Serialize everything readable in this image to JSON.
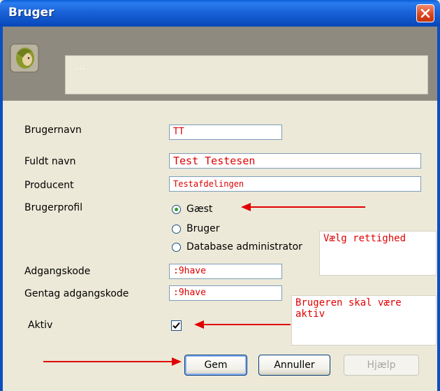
{
  "window": {
    "title": "Bruger"
  },
  "header": {
    "field_text": "..."
  },
  "form": {
    "username": {
      "label": "Brugernavn",
      "value": "TT"
    },
    "fullname": {
      "label": "Fuldt navn",
      "value": "Test Testesen"
    },
    "producer": {
      "label": "Producent",
      "value": "Testafdelingen"
    },
    "profile": {
      "label": "Brugerprofil",
      "options": [
        "Gæst",
        "Bruger",
        "Database administrator"
      ],
      "selected": "Gæst"
    },
    "password": {
      "label": "Adgangskode",
      "value": ":9have"
    },
    "password_repeat": {
      "label": "Gentag adgangskode",
      "value": ":9have"
    },
    "active": {
      "label": "Aktiv",
      "checked": true
    }
  },
  "annotations": {
    "rights_note": "Vælg rettighed",
    "active_note": "Brugeren skal være aktiv"
  },
  "buttons": {
    "save": "Gem",
    "cancel": "Annuller",
    "help": "Hjælp"
  },
  "colors": {
    "annotation": "#e00000",
    "titlebar": "#1a62d8"
  }
}
